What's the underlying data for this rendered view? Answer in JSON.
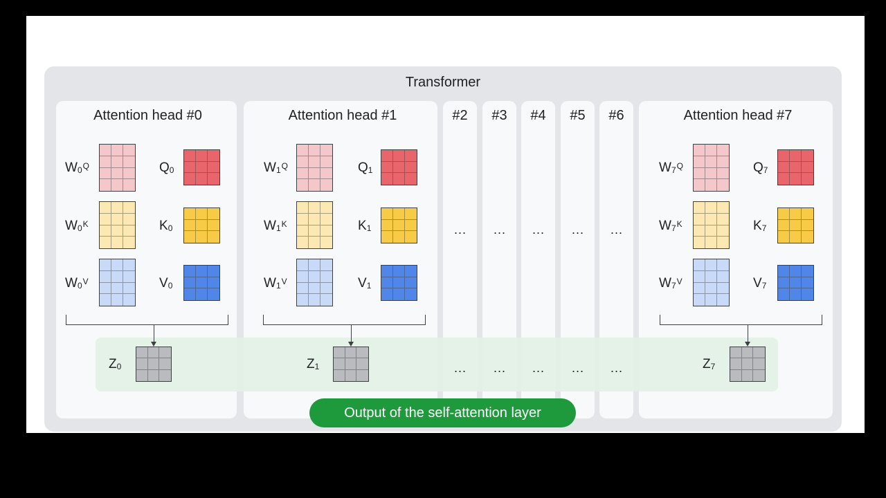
{
  "title": "Transformer",
  "heads": [
    {
      "title": "Attention head #0",
      "weights": [
        {
          "base": "W",
          "sub": "0",
          "sup": "Q"
        },
        {
          "base": "W",
          "sub": "0",
          "sup": "K"
        },
        {
          "base": "W",
          "sub": "0",
          "sup": "V"
        }
      ],
      "outputs": [
        {
          "base": "Q",
          "sub": "0"
        },
        {
          "base": "K",
          "sub": "0"
        },
        {
          "base": "V",
          "sub": "0"
        }
      ],
      "z": {
        "base": "Z",
        "sub": "0"
      }
    },
    {
      "title": "Attention head #1",
      "weights": [
        {
          "base": "W",
          "sub": "1",
          "sup": "Q"
        },
        {
          "base": "W",
          "sub": "1",
          "sup": "K"
        },
        {
          "base": "W",
          "sub": "1",
          "sup": "V"
        }
      ],
      "outputs": [
        {
          "base": "Q",
          "sub": "1"
        },
        {
          "base": "K",
          "sub": "1"
        },
        {
          "base": "V",
          "sub": "1"
        }
      ],
      "z": {
        "base": "Z",
        "sub": "1"
      }
    },
    {
      "title": "Attention head #7",
      "weights": [
        {
          "base": "W",
          "sub": "7",
          "sup": "Q"
        },
        {
          "base": "W",
          "sub": "7",
          "sup": "K"
        },
        {
          "base": "W",
          "sub": "7",
          "sup": "V"
        }
      ],
      "outputs": [
        {
          "base": "Q",
          "sub": "7"
        },
        {
          "base": "K",
          "sub": "7"
        },
        {
          "base": "V",
          "sub": "7"
        }
      ],
      "z": {
        "base": "Z",
        "sub": "7"
      }
    }
  ],
  "middle_heads": [
    {
      "title": "#2",
      "ellipsis": "...",
      "z_ellipsis": "..."
    },
    {
      "title": "#3",
      "ellipsis": "...",
      "z_ellipsis": "..."
    },
    {
      "title": "#4",
      "ellipsis": "...",
      "z_ellipsis": "..."
    },
    {
      "title": "#5",
      "ellipsis": "...",
      "z_ellipsis": "..."
    },
    {
      "title": "#6",
      "ellipsis": "...",
      "z_ellipsis": "..."
    }
  ],
  "output_label": "Output of the self-attention layer",
  "colors": {
    "query_weight": "#f4c7cb",
    "query": "#e8656b",
    "key_weight": "#fce8b2",
    "key": "#f8cb46",
    "value_weight": "#c9daf8",
    "value": "#4f86e8",
    "z": "#b9bbbe",
    "output_pill": "#1e9a3c",
    "band": "#e3f1e5"
  }
}
